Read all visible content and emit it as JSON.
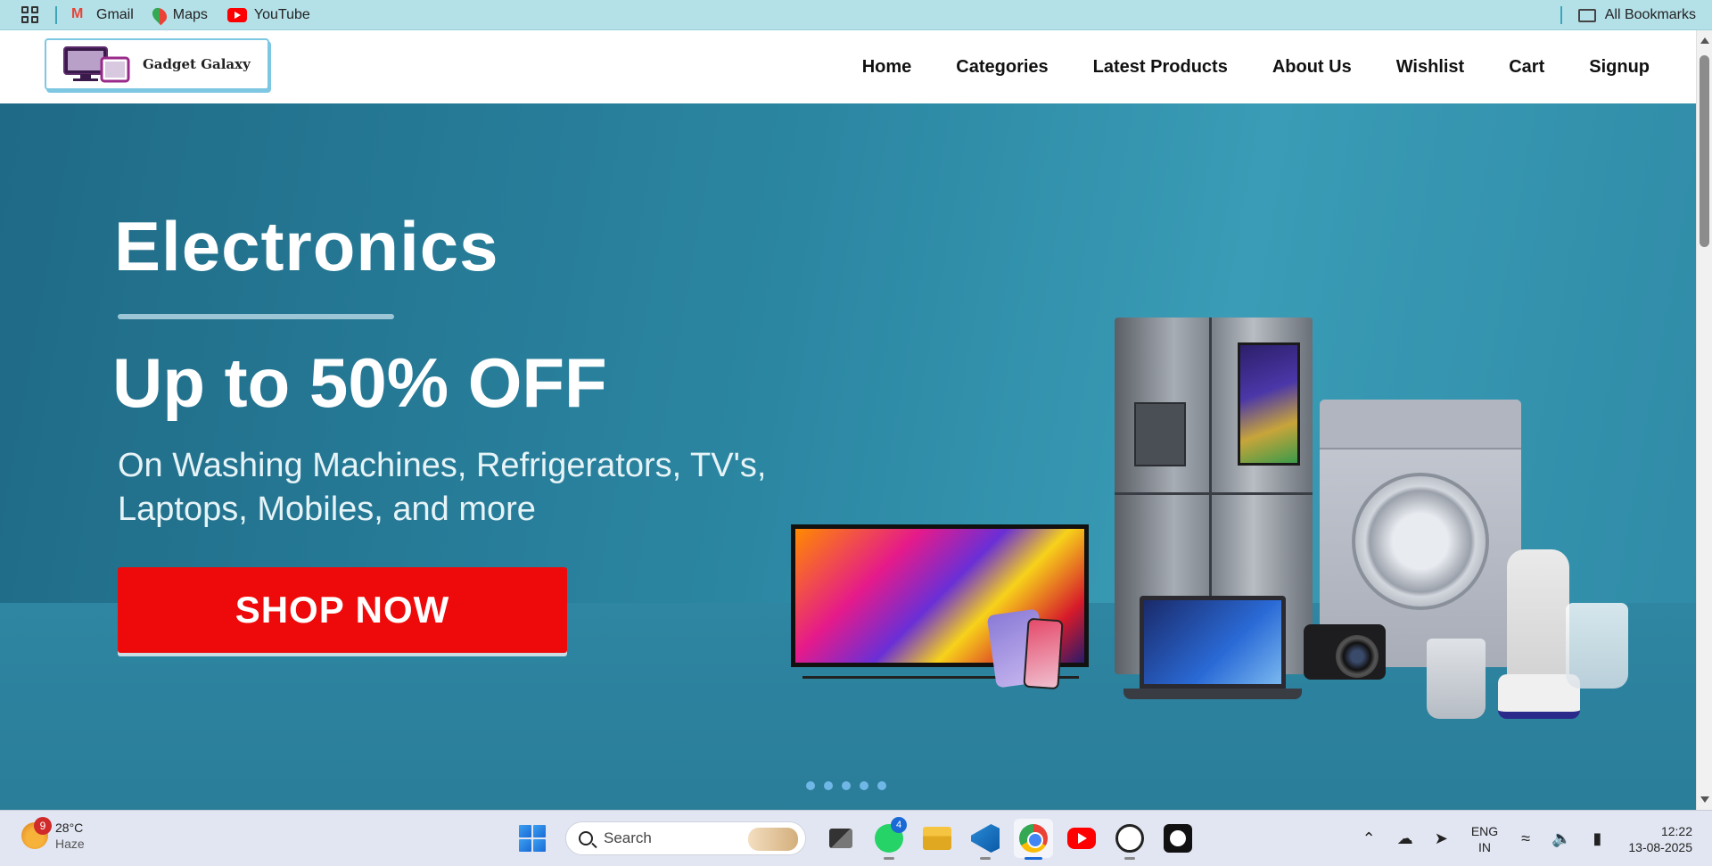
{
  "bookmarks": {
    "items": [
      {
        "label": "Gmail",
        "icon": "gmail-icon"
      },
      {
        "label": "Maps",
        "icon": "maps-icon"
      },
      {
        "label": "YouTube",
        "icon": "youtube-icon"
      }
    ],
    "all_bookmarks": "All Bookmarks"
  },
  "site": {
    "logo_text": "Gadget Galaxy",
    "nav": [
      "Home",
      "Categories",
      "Latest Products",
      "About Us",
      "Wishlist",
      "Cart",
      "Signup"
    ]
  },
  "hero": {
    "title": "Electronics",
    "offer": "Up to 50% OFF",
    "subtitle_line1": "On Washing Machines, Refrigerators, TV's,",
    "subtitle_line2": "Laptops, Mobiles, and more",
    "cta": "SHOP NOW",
    "slide_count": 5,
    "colors": {
      "cta": "#ee0a0a",
      "background": "#2b86a2"
    }
  },
  "taskbar": {
    "weather": {
      "temp": "28°C",
      "condition": "Haze",
      "badge": "9"
    },
    "search_placeholder": "Search",
    "whatsapp_badge": "4",
    "apps": [
      "task-view-icon",
      "whatsapp-icon",
      "file-explorer-icon",
      "vscode-icon",
      "chrome-icon",
      "youtube-icon",
      "chatgpt-icon",
      "github-icon"
    ],
    "lang_line1": "ENG",
    "lang_line2": "IN",
    "time": "12:22",
    "date": "13-08-2025"
  }
}
